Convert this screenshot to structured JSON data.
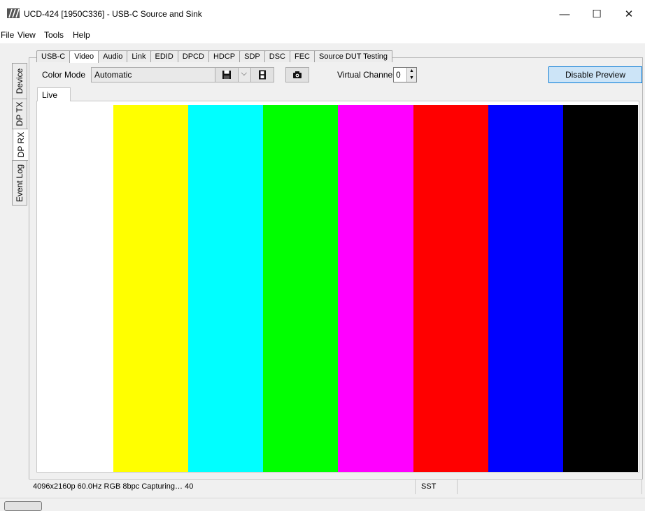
{
  "window": {
    "title": "UCD-424 [1950C336] - USB-C Source and Sink",
    "minimize": "—",
    "maximize": "☐",
    "close": "✕"
  },
  "menu": [
    "File",
    "View",
    "Tools",
    "Help"
  ],
  "side_tabs": [
    {
      "label": "Device",
      "active": false
    },
    {
      "label": "DP TX",
      "active": false
    },
    {
      "label": "DP RX",
      "active": true
    },
    {
      "label": "Event Log",
      "active": false
    }
  ],
  "tabs": [
    {
      "label": "USB-C",
      "active": false
    },
    {
      "label": "Video",
      "active": true
    },
    {
      "label": "Audio",
      "active": false
    },
    {
      "label": "Link",
      "active": false
    },
    {
      "label": "EDID",
      "active": false
    },
    {
      "label": "DPCD",
      "active": false
    },
    {
      "label": "HDCP",
      "active": false
    },
    {
      "label": "SDP",
      "active": false
    },
    {
      "label": "DSC",
      "active": false
    },
    {
      "label": "FEC",
      "active": false
    },
    {
      "label": "Source DUT Testing",
      "active": false
    }
  ],
  "toolbar": {
    "color_mode_label": "Color Mode",
    "color_mode_value": "Automatic",
    "virtual_channel_label": "Virtual Channel:",
    "virtual_channel_value": "0",
    "disable_preview_label": "Disable Preview",
    "icons": [
      "save-icon",
      "film-icon",
      "camera-icon"
    ]
  },
  "preview": {
    "tab_label": "Live",
    "color_bars": [
      "#ffff00",
      "#00ffff",
      "#00ff00",
      "#ff00ff",
      "#ff0000",
      "#0000ff",
      "#000000"
    ]
  },
  "status": {
    "main": "4096x2160p 60.0Hz RGB 8bpc Capturing… 40",
    "mode": "SST"
  }
}
